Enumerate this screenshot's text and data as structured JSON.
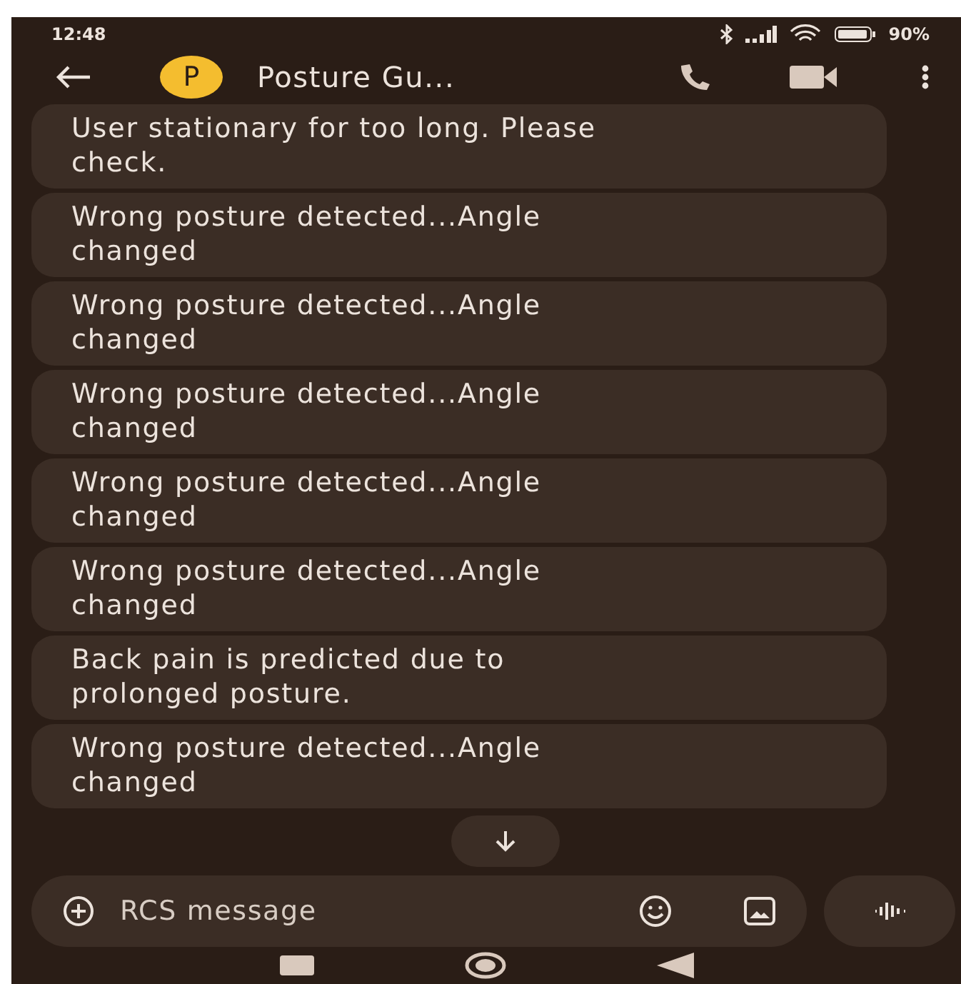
{
  "status_bar": {
    "time": "12:48",
    "battery": "90%"
  },
  "header": {
    "avatar_letter": "P",
    "title": "Posture Gu..."
  },
  "messages": [
    {
      "text": "User stationary for too long. Please\ncheck."
    },
    {
      "text": "Wrong posture detected...Angle\nchanged"
    },
    {
      "text": "Wrong posture detected...Angle\nchanged"
    },
    {
      "text": "Wrong posture detected...Angle\nchanged"
    },
    {
      "text": "Wrong posture detected...Angle\nchanged"
    },
    {
      "text": "Wrong posture detected...Angle\nchanged"
    },
    {
      "text": "Back pain is predicted due to\nprolonged posture."
    },
    {
      "text": "Wrong posture detected...Angle\nchanged"
    }
  ],
  "composer": {
    "placeholder": "RCS message"
  }
}
